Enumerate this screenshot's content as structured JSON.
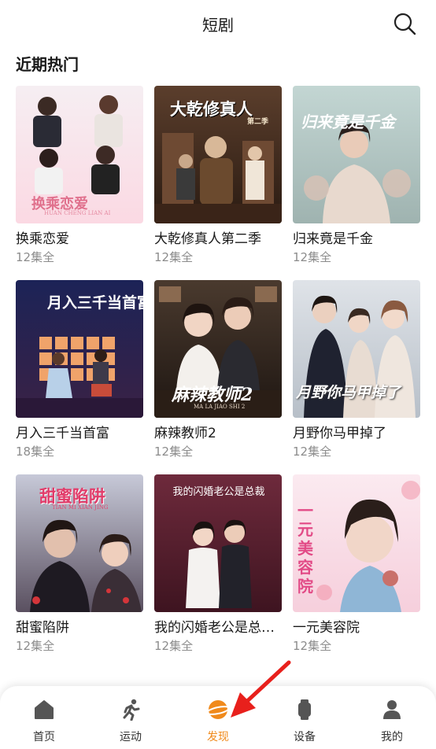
{
  "header": {
    "title": "短剧",
    "search_icon": "search-icon"
  },
  "section": {
    "title": "近期热门"
  },
  "dramas": [
    {
      "title": "换乘恋爱",
      "episodes": "12集全",
      "poster_text": "换乘恋爱",
      "poster_subtext": "HUAN CHENG LIAN AI"
    },
    {
      "title": "大乾修真人第二季",
      "episodes": "12集全",
      "poster_text": "大乾修真人",
      "poster_subtext": "第二季"
    },
    {
      "title": "归来竟是千金",
      "episodes": "12集全",
      "poster_text": "归来竟是千金",
      "poster_subtext": ""
    },
    {
      "title": "月入三千当首富",
      "episodes": "18集全",
      "poster_text": "月入三千当首富",
      "poster_subtext": ""
    },
    {
      "title": "麻辣教师2",
      "episodes": "12集全",
      "poster_text": "麻辣教师2",
      "poster_subtext": "MA LA JIAO SHI 2"
    },
    {
      "title": "月野你马甲掉了",
      "episodes": "12集全",
      "poster_text": "月野你马甲掉了",
      "poster_subtext": ""
    },
    {
      "title": "甜蜜陷阱",
      "episodes": "12集全",
      "poster_text": "甜蜜陷阱",
      "poster_subtext": "TIAN MI XIAN JING"
    },
    {
      "title": "我的闪婚老公是总…",
      "episodes": "12集全",
      "poster_text": "我的闪婚老公是总裁",
      "poster_subtext": ""
    },
    {
      "title": "一元美容院",
      "episodes": "12集全",
      "poster_text": "一元美容院",
      "poster_subtext": ""
    }
  ],
  "tabbar": {
    "items": [
      {
        "label": "首页",
        "icon": "home-icon"
      },
      {
        "label": "运动",
        "icon": "running-icon"
      },
      {
        "label": "发现",
        "icon": "discover-icon",
        "active": true
      },
      {
        "label": "设备",
        "icon": "watch-icon"
      },
      {
        "label": "我的",
        "icon": "person-icon"
      }
    ]
  },
  "colors": {
    "accent": "#f08a1c",
    "annotation_arrow": "#e8201c"
  }
}
